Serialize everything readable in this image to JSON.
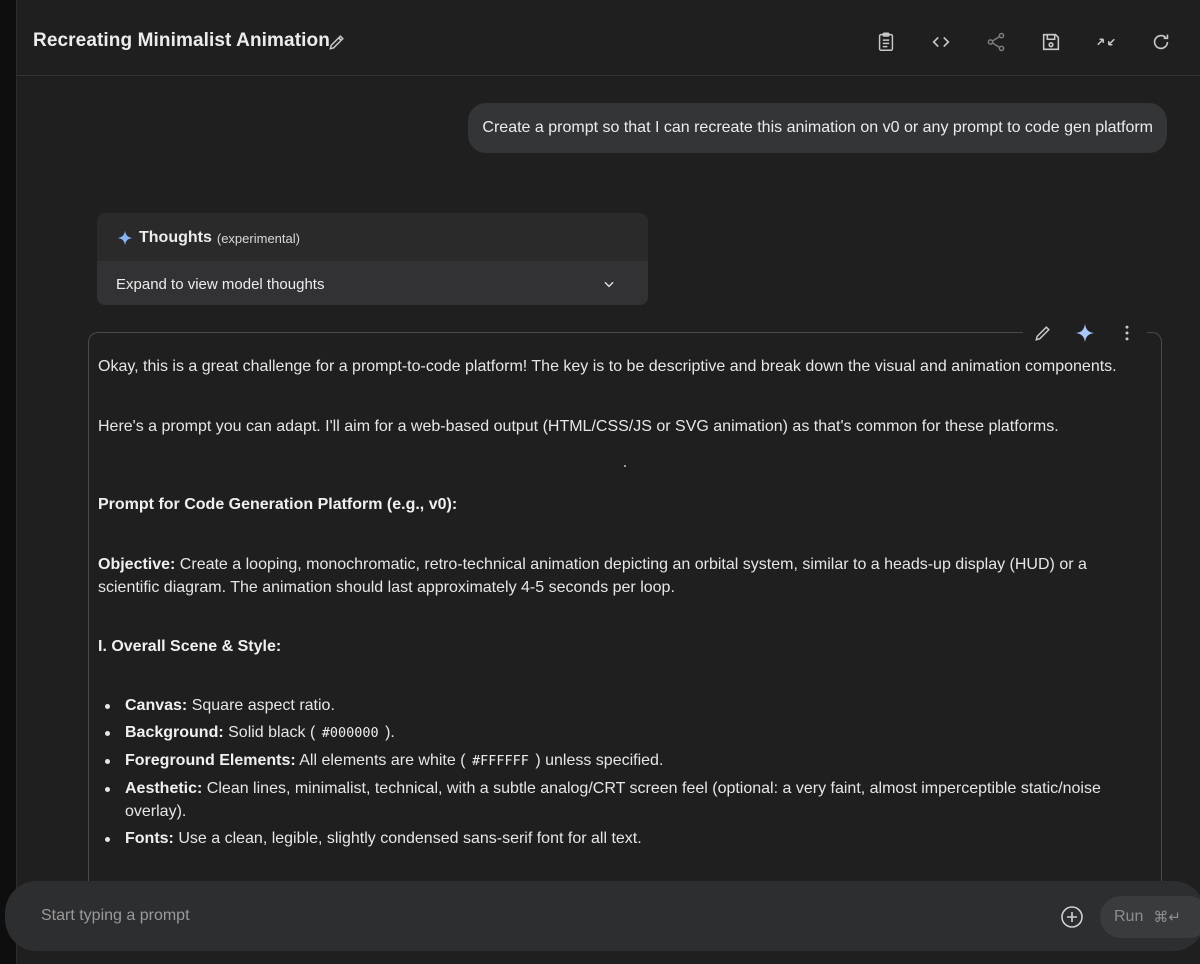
{
  "header": {
    "title": "Recreating Minimalist Animation",
    "toolbar": [
      "clipboard-icon",
      "code-icon",
      "share-icon",
      "save-icon",
      "collapse-icon",
      "refresh-icon"
    ]
  },
  "user_message": "Create a prompt so that I can recreate this animation on v0 or any prompt to code gen platform",
  "thoughts": {
    "title": "Thoughts",
    "tag": "(experimental)",
    "expand_label": "Expand to view model thoughts"
  },
  "response": {
    "p1": "Okay, this is a great challenge for a prompt-to-code platform! The key is to be descriptive and break down the visual and animation components.",
    "p2": "Here's a prompt you can adapt. I'll aim for a web-based output (HTML/CSS/JS or SVG animation) as that's common for these platforms.",
    "heading": "Prompt for Code Generation Platform (e.g., v0):",
    "objective_label": "Objective:",
    "objective_text": " Create a looping, monochromatic, retro-technical animation depicting an orbital system, similar to a heads-up display (HUD) or a scientific diagram. The animation should last approximately 4-5 seconds per loop.",
    "section1": "I. Overall Scene & Style:",
    "bullets": [
      {
        "label": "Canvas:",
        "text": " Square aspect ratio."
      },
      {
        "label": "Background:",
        "pre": " Solid black ( ",
        "code": "#000000",
        "post": " )."
      },
      {
        "label": "Foreground Elements:",
        "pre": " All elements are white ( ",
        "code": "#FFFFFF",
        "post": " ) unless specified."
      },
      {
        "label": "Aesthetic:",
        "text": " Clean lines, minimalist, technical, with a subtle analog/CRT screen feel (optional: a very faint, almost imperceptible static/noise overlay)."
      },
      {
        "label": "Fonts:",
        "text": " Use a clean, legible, slightly condensed sans-serif font for all text."
      }
    ]
  },
  "prompt": {
    "placeholder": "Start typing a prompt",
    "run_label": "Run",
    "shortcut": "⌘↵"
  },
  "colors": {
    "background": "#1f1f1f",
    "bubble": "#333537",
    "accent_spark": "#8ab4f8"
  }
}
